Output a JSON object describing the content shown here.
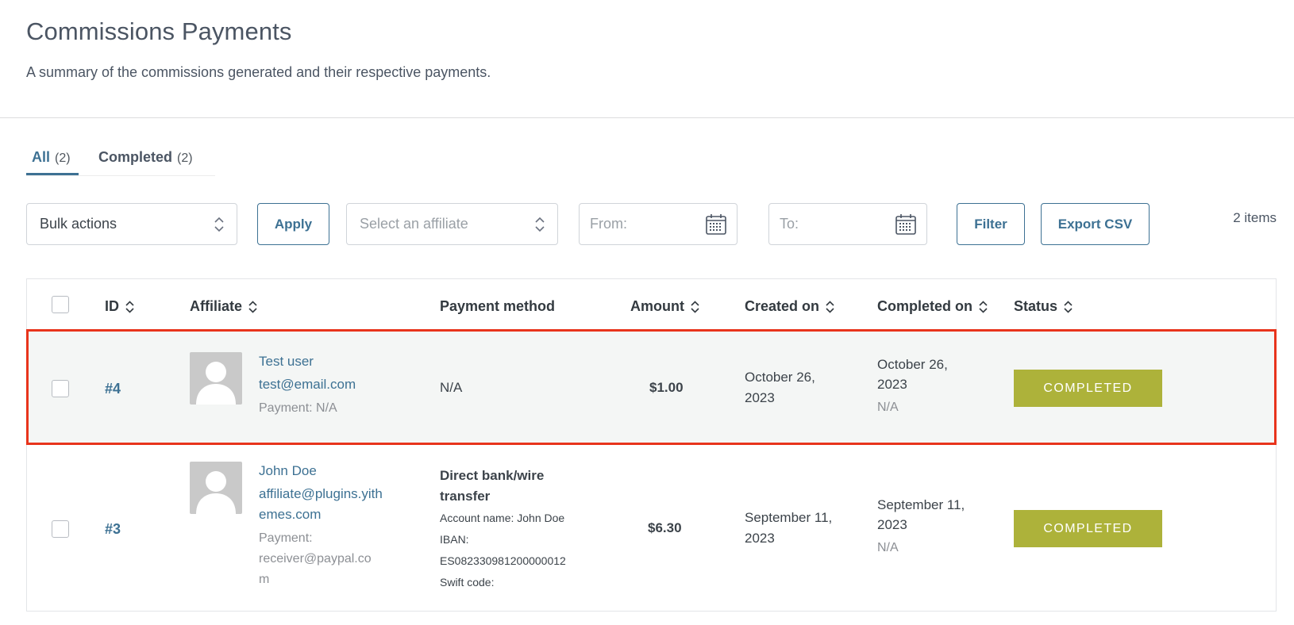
{
  "header": {
    "title": "Commissions Payments",
    "description": "A summary of the commissions generated and their respective payments."
  },
  "tabs": [
    {
      "label": "All",
      "count": "(2)",
      "active": true
    },
    {
      "label": "Completed",
      "count": "(2)",
      "active": false
    }
  ],
  "toolbar": {
    "bulk_actions": "Bulk actions",
    "apply": "Apply",
    "affiliate_placeholder": "Select an affiliate",
    "from_placeholder": "From:",
    "to_placeholder": "To:",
    "filter": "Filter",
    "export": "Export CSV",
    "items_count": "2 items"
  },
  "table": {
    "columns": {
      "id": "ID",
      "affiliate": "Affiliate",
      "payment_method": "Payment method",
      "amount": "Amount",
      "created_on": "Created on",
      "completed_on": "Completed on",
      "status": "Status"
    },
    "rows": [
      {
        "id": "#4",
        "affiliate_name": "Test user",
        "affiliate_email": "test@email.com",
        "affiliate_payment": "Payment: N/A",
        "payment_method": "N/A",
        "amount": "$1.00",
        "created_on_1": "October 26,",
        "created_on_2": "2023",
        "completed_on_1": "October 26,",
        "completed_on_2": "2023",
        "completed_note": "N/A",
        "status": "COMPLETED"
      },
      {
        "id": "#3",
        "affiliate_name": "John Doe",
        "affiliate_email_1": "affiliate@plugins.yith",
        "affiliate_email_2": "emes.com",
        "affiliate_payment_1": "Payment:",
        "affiliate_payment_2": "receiver@paypal.co",
        "affiliate_payment_3": "m",
        "payment_method_1": "Direct bank/wire",
        "payment_method_2": "transfer",
        "account_name": "Account name: John Doe",
        "iban_label": "IBAN:",
        "iban_value": "ES082330981200000012",
        "swift": "Swift code:",
        "amount": "$6.30",
        "created_on_1": "September 11,",
        "created_on_2": "2023",
        "completed_on_1": "September 11,",
        "completed_on_2": "2023",
        "completed_note": "N/A",
        "status": "COMPLETED"
      }
    ]
  },
  "colors": {
    "accent": "#3d7193",
    "status_completed": "#adb23a",
    "highlight_border": "#e8341c"
  }
}
